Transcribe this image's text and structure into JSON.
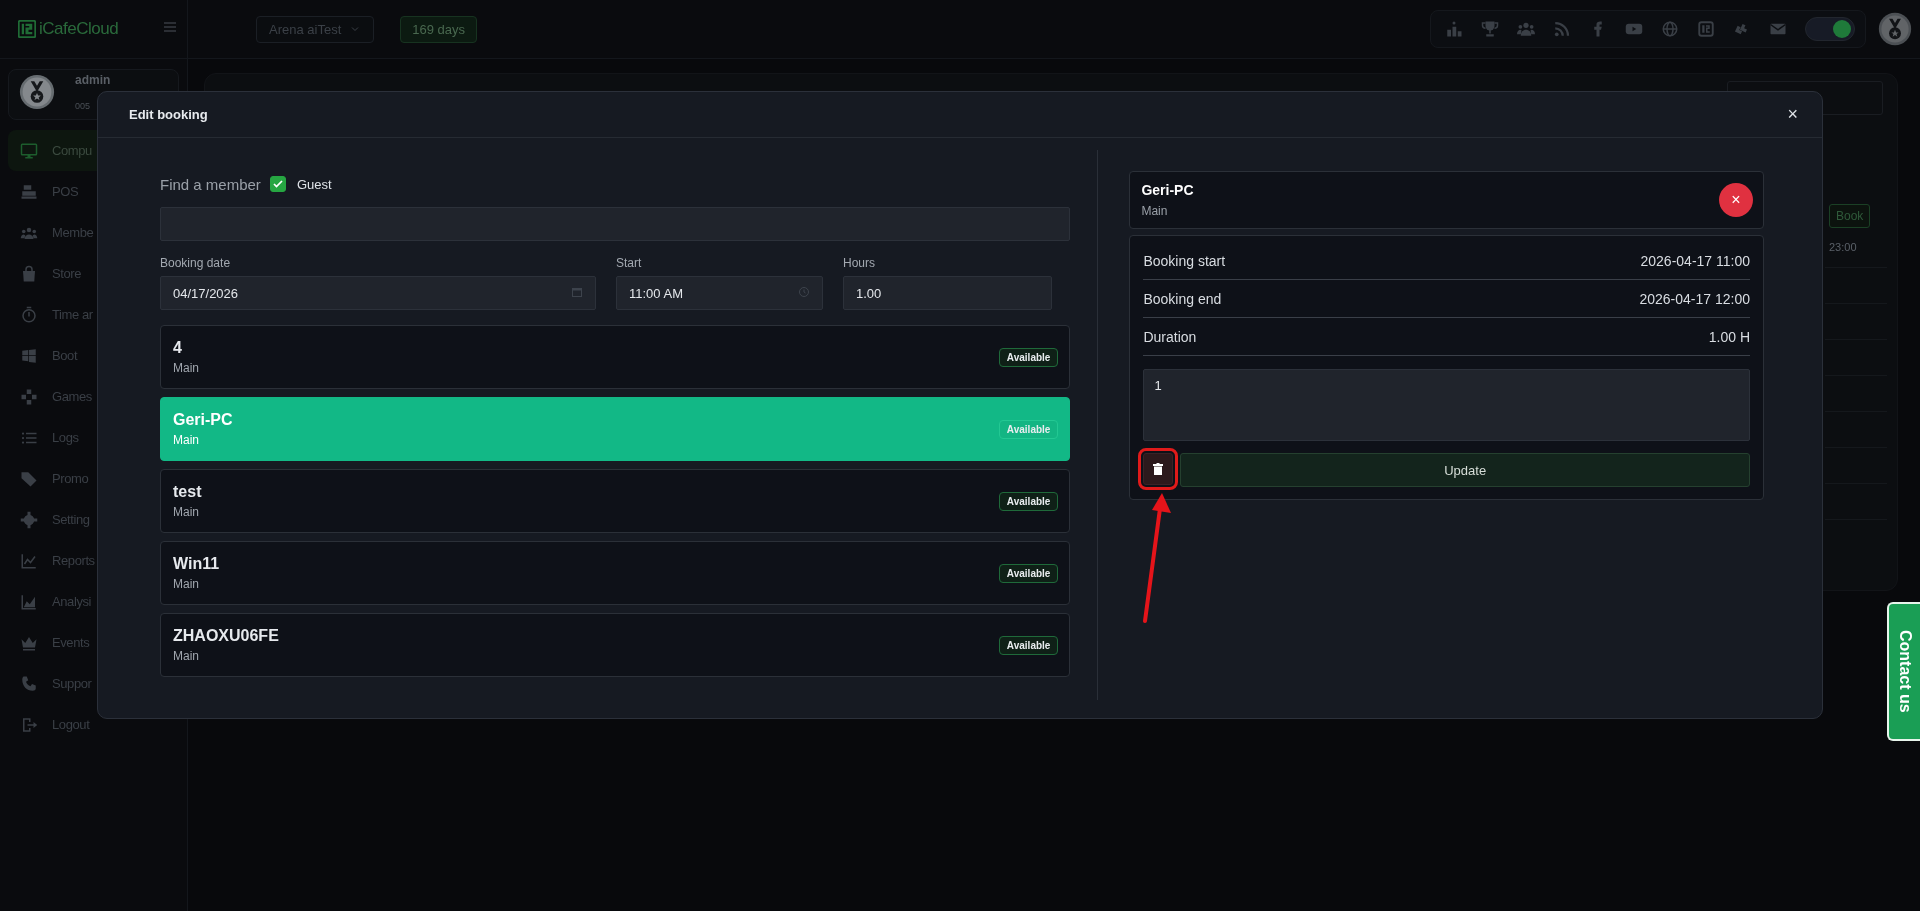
{
  "topbar": {
    "logo": "iCafeCloud",
    "branch": "Arena aiTest",
    "days_badge": "169 days",
    "theme_toggle": {
      "on": true
    }
  },
  "sidebar": {
    "user": {
      "name": "admin",
      "id": "005"
    },
    "items": [
      {
        "label": "Compu",
        "selected": true
      },
      {
        "label": "POS",
        "selected": false
      },
      {
        "label": "Membe",
        "selected": false
      },
      {
        "label": "Store",
        "selected": false
      },
      {
        "label": "Time ar",
        "selected": false
      },
      {
        "label": "Boot",
        "selected": false
      },
      {
        "label": "Games",
        "selected": false
      },
      {
        "label": "Logs",
        "selected": false
      },
      {
        "label": "Promo",
        "selected": false
      },
      {
        "label": "Setting",
        "selected": false
      },
      {
        "label": "Reports",
        "selected": false
      },
      {
        "label": "Analysi",
        "selected": false
      },
      {
        "label": "Events",
        "selected": false
      },
      {
        "label": "Suppor",
        "selected": false
      },
      {
        "label": "Logout",
        "selected": false
      }
    ]
  },
  "background": {
    "book_button": "Book",
    "time_label": "23:00"
  },
  "modal": {
    "title": "Edit booking",
    "close": "×",
    "find_member_label": "Find a member",
    "guest": {
      "label": "Guest",
      "checked": true
    },
    "fields": [
      {
        "label": "Booking date",
        "value": "04/17/2026",
        "kind": "date"
      },
      {
        "label": "Start",
        "value": "11:00 AM",
        "kind": "time"
      },
      {
        "label": "Hours",
        "value": "1.00",
        "kind": "number"
      }
    ],
    "pcs": [
      {
        "name": "4",
        "group": "Main",
        "status": "Available",
        "selected": false
      },
      {
        "name": "Geri-PC",
        "group": "Main",
        "status": "Available",
        "selected": true
      },
      {
        "name": "test",
        "group": "Main",
        "status": "Available",
        "selected": false
      },
      {
        "name": "Win11",
        "group": "Main",
        "status": "Available",
        "selected": false
      },
      {
        "name": "ZHAOXU06FE",
        "group": "Main",
        "status": "Available",
        "selected": false
      }
    ],
    "selected_pc": {
      "name": "Geri-PC",
      "group": "Main",
      "remove": "×"
    },
    "details": [
      {
        "label": "Booking start",
        "value": "2026-04-17 11:00"
      },
      {
        "label": "Booking end",
        "value": "2026-04-17 12:00"
      },
      {
        "label": "Duration",
        "value": "1.00 H"
      }
    ],
    "note": "1",
    "delete_button": {
      "highlighted": true
    },
    "update_button": "Update"
  },
  "contact_tab": "Contact us"
}
